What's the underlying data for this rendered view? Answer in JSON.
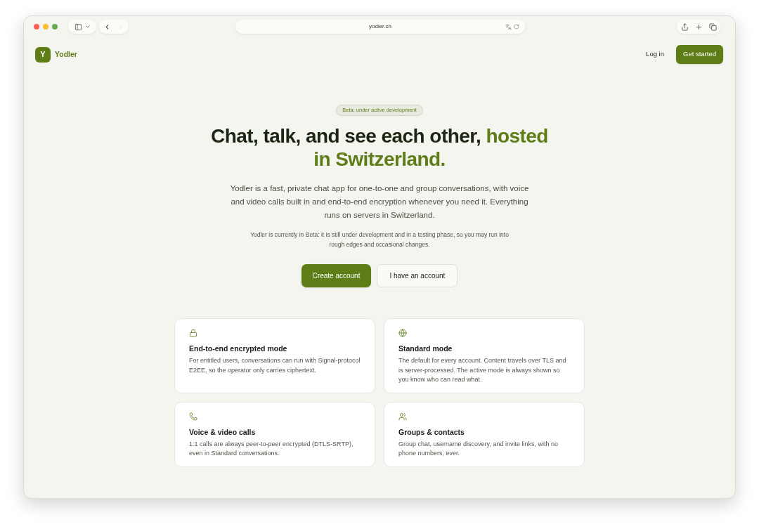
{
  "browser": {
    "url": "yodler.ch",
    "nav_buttons": [
      {
        "kind": "back",
        "disabled": false
      },
      {
        "kind": "forward",
        "disabled": true
      }
    ]
  },
  "header": {
    "logo_letter": "Y",
    "brand": "Yodler",
    "links": [
      {
        "label": "Log in",
        "kind": "link"
      },
      {
        "label": "Get started",
        "kind": "primary"
      }
    ]
  },
  "hero": {
    "badge": "Beta: under active development",
    "headline": [
      {
        "text": "Chat, talk, and see each other, ",
        "accent": false
      },
      {
        "text": "hosted in Switzerland.",
        "accent": true
      }
    ],
    "intro": "Yodler is a fast, private chat app for one-to-one and group conversations, with voice and video calls built in and end-to-end encryption whenever you need it. Everything runs on servers in Switzerland.",
    "beta_note": "Yodler is currently in Beta: it is still under development and in a testing phase, so you may run into rough edges and occasional changes.",
    "buttons": [
      {
        "label": "Create account",
        "kind": "primary"
      },
      {
        "label": "I have an account",
        "kind": "secondary"
      }
    ]
  },
  "features": [
    {
      "kind": "lock",
      "title": "End-to-end encrypted mode",
      "text": "For entitled users, conversations can run with Signal-protocol E2EE, so the operator only carries ciphertext."
    },
    {
      "kind": "globe",
      "title": "Standard mode",
      "text": "The default for every account. Content travels over TLS and is server-processed. The active mode is always shown so you know who can read what."
    },
    {
      "kind": "phone",
      "title": "Voice & video calls",
      "text": "1:1 calls are always peer-to-peer encrypted (DTLS-SRTP), even in Standard conversations."
    },
    {
      "kind": "users",
      "title": "Groups & contacts",
      "text": "Group chat, username discovery, and invite links, with no phone numbers, ever."
    }
  ]
}
